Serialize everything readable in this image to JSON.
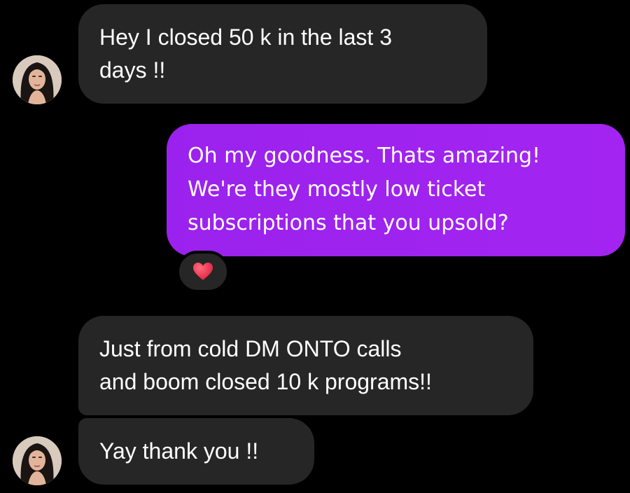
{
  "conversation": {
    "messages": [
      {
        "direction": "incoming",
        "text": "Hey I closed 50 k in the last 3\ndays !!"
      },
      {
        "direction": "outgoing",
        "text": "Oh my goodness. Thats amazing!\nWe're they mostly low ticket\nsubscriptions that you upsold?",
        "reaction": "heart-emoji"
      },
      {
        "direction": "incoming",
        "text": "Just from cold DM ONTO calls\nand boom closed 10 k programs!!"
      },
      {
        "direction": "incoming",
        "text": "Yay thank you !!"
      }
    ]
  },
  "colors": {
    "background": "#000000",
    "incoming_bubble": "#262626",
    "outgoing_bubble": "#a020f0",
    "text": "#ffffff",
    "reaction_heart": "#e8344e"
  }
}
